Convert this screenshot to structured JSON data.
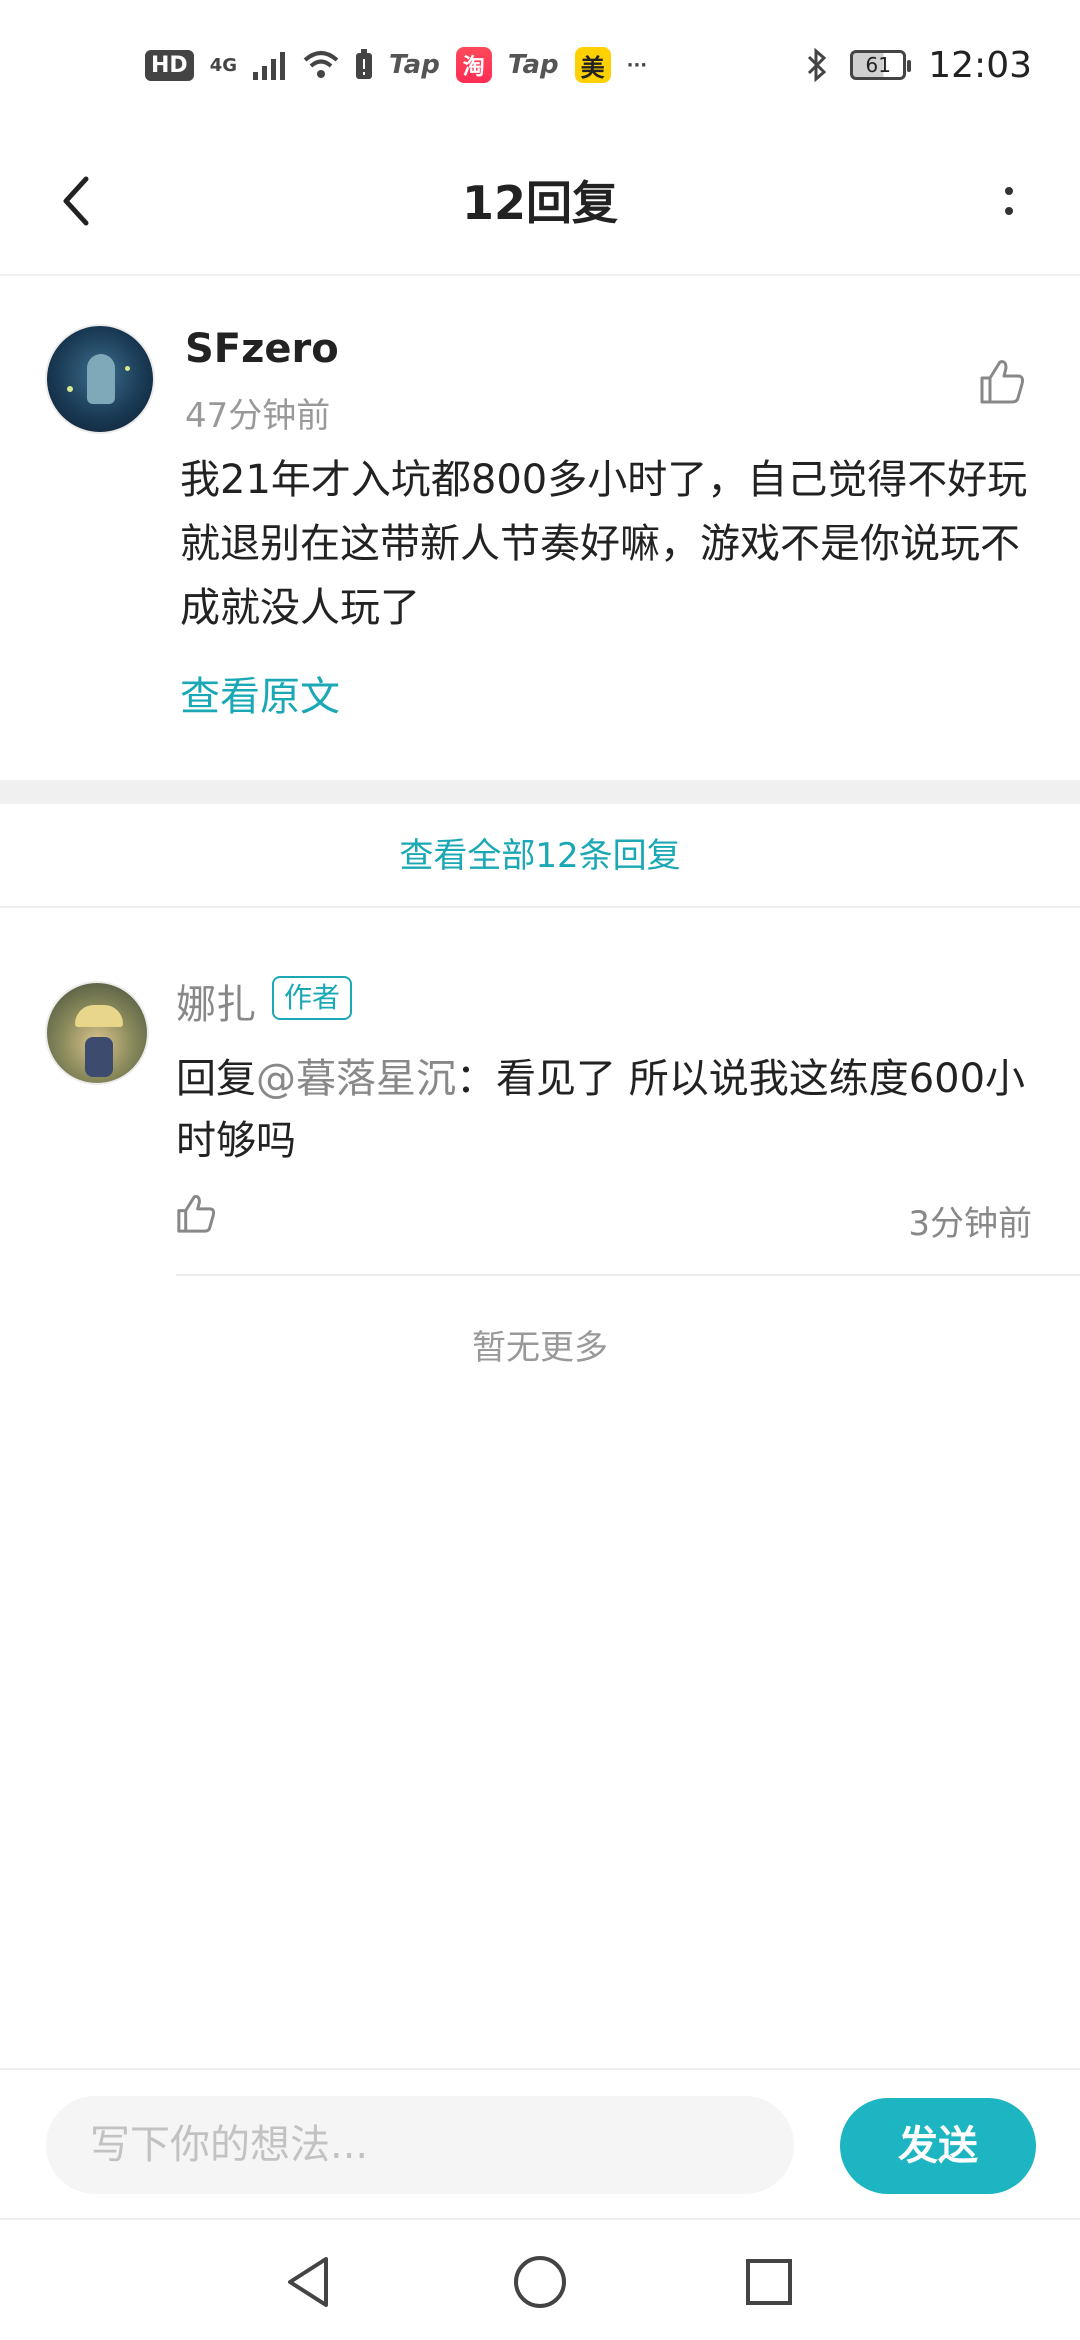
{
  "status_bar": {
    "hd": "HD",
    "network": "4G",
    "app1_label": "Tap",
    "app1_icon": "淘",
    "app2_label": "Tap",
    "app2_icon": "美",
    "overflow": "···",
    "battery": "61",
    "time": "12:03"
  },
  "header": {
    "title": "12回复"
  },
  "main_comment": {
    "username": "SFzero",
    "time": "47分钟前",
    "content": "我21年才入坑都800多小时了，自己觉得不好玩就退别在这带新人节奏好嘛，游戏不是你说玩不成就没人玩了",
    "view_original": "查看原文"
  },
  "view_all": "查看全部12条回复",
  "reply": {
    "username": "娜扎",
    "badge": "作者",
    "prefix": "回复",
    "mention": "@暮落星沉",
    "content": "：看见了 所以说我这练度600小时够吗",
    "time": "3分钟前"
  },
  "no_more": "暂无更多",
  "composer": {
    "placeholder": "写下你的想法...",
    "send": "发送"
  },
  "colors": {
    "accent": "#1cb5c1",
    "link": "#1ba8b5"
  }
}
